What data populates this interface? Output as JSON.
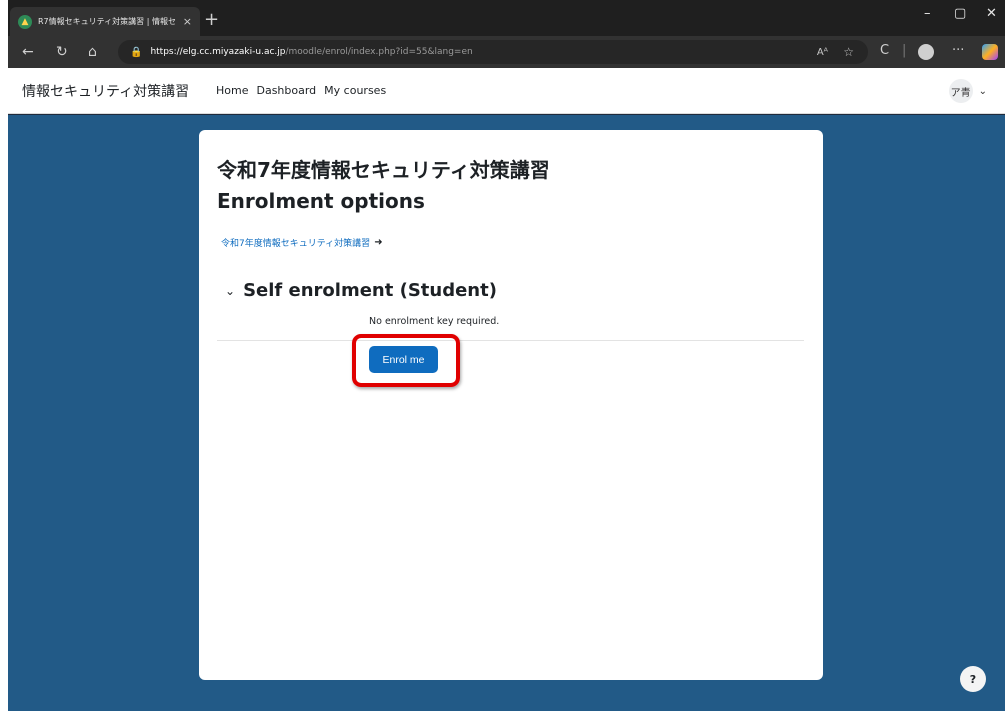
{
  "browser": {
    "tab_title": "R7情報セキュリティ対策講習 | 情報セ",
    "tab_close": "×",
    "new_tab": "+",
    "url_host": "https://elg.cc.miyazaki-u.ac.jp",
    "url_path": "/moodle/enrol/index.php?id=55&lang=en",
    "read_aloud": "Aᴬ",
    "more": "···"
  },
  "navbar": {
    "site_name": "情報セキュリティ対策講習",
    "links": [
      "Home",
      "Dashboard",
      "My courses"
    ],
    "user_initials": "ア青"
  },
  "main": {
    "course_title": "令和7年度情報セキュリティ対策講習",
    "page_title": "Enrolment options",
    "course_link": "令和7年度情報セキュリティ対策講習",
    "section_title": "Self enrolment (Student)",
    "no_key_text": "No enrolment key required.",
    "enrol_button": "Enrol me"
  },
  "help_label": "?",
  "colors": {
    "accent": "#0f6cbf",
    "page_bg": "#225a87",
    "highlight": "#e00000"
  }
}
